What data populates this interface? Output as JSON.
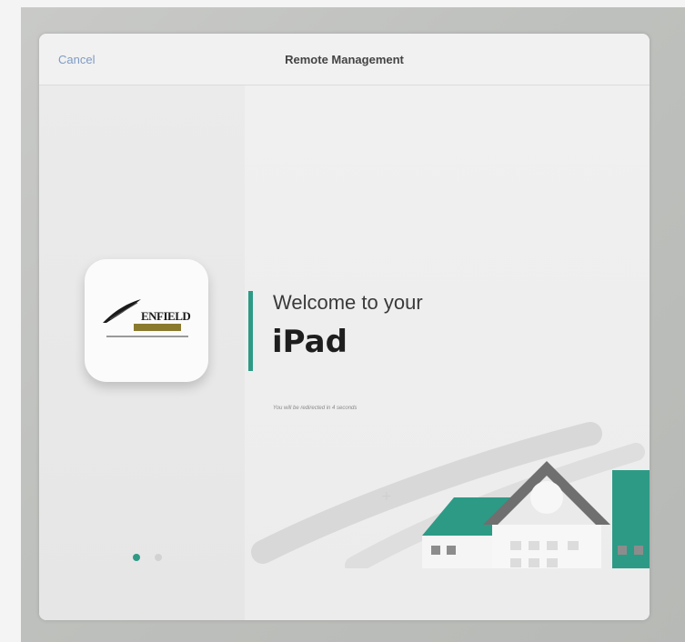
{
  "nav": {
    "cancel_label": "Cancel",
    "title": "Remote Management"
  },
  "logo": {
    "name": "ENFIELD",
    "subtitle": "PUBLIC SCHOOLS"
  },
  "welcome": {
    "line1": "Welcome to your",
    "device": "iPad",
    "redirect": "You will be redirected in 4 seconds"
  },
  "pager": {
    "page_count": 2,
    "active_index": 0
  },
  "colors": {
    "accent": "#2d9a86",
    "link": "#7f9bc4"
  }
}
